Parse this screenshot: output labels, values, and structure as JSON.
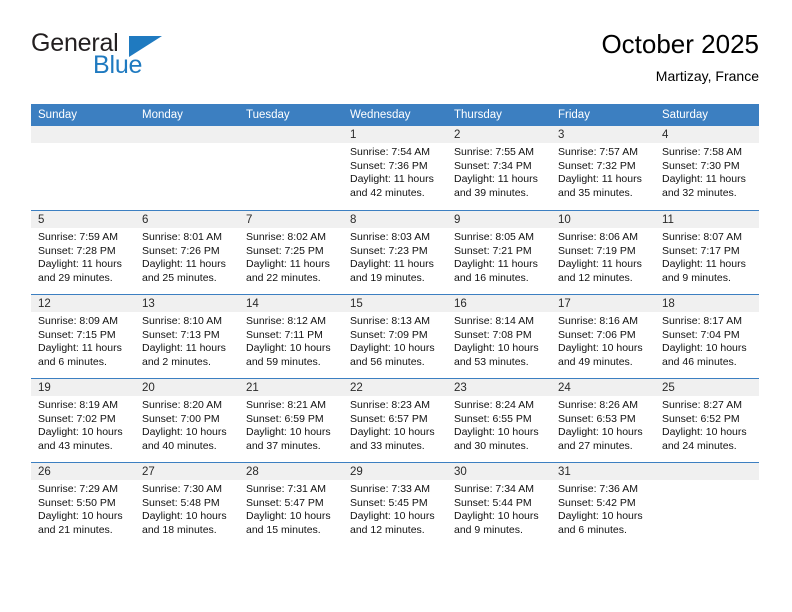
{
  "brand": {
    "name_top": "General",
    "name_bottom": "Blue",
    "triangle_color": "#1f7ac0",
    "text_color": "#231f20"
  },
  "header": {
    "title": "October 2025",
    "subtitle": "Martizay, France"
  },
  "theme": {
    "header_row_bg": "#3c7fc1",
    "header_row_text": "#ffffff",
    "daynum_band_bg": "#f0f0f0",
    "week_separator": "#3c7fc1"
  },
  "weekday_headers": [
    "Sunday",
    "Monday",
    "Tuesday",
    "Wednesday",
    "Thursday",
    "Friday",
    "Saturday"
  ],
  "weeks": [
    [
      {
        "day": "",
        "sunrise": "",
        "sunset": "",
        "daylight_line1": "",
        "daylight_line2": ""
      },
      {
        "day": "",
        "sunrise": "",
        "sunset": "",
        "daylight_line1": "",
        "daylight_line2": ""
      },
      {
        "day": "",
        "sunrise": "",
        "sunset": "",
        "daylight_line1": "",
        "daylight_line2": ""
      },
      {
        "day": "1",
        "sunrise": "Sunrise: 7:54 AM",
        "sunset": "Sunset: 7:36 PM",
        "daylight_line1": "Daylight: 11 hours",
        "daylight_line2": "and 42 minutes."
      },
      {
        "day": "2",
        "sunrise": "Sunrise: 7:55 AM",
        "sunset": "Sunset: 7:34 PM",
        "daylight_line1": "Daylight: 11 hours",
        "daylight_line2": "and 39 minutes."
      },
      {
        "day": "3",
        "sunrise": "Sunrise: 7:57 AM",
        "sunset": "Sunset: 7:32 PM",
        "daylight_line1": "Daylight: 11 hours",
        "daylight_line2": "and 35 minutes."
      },
      {
        "day": "4",
        "sunrise": "Sunrise: 7:58 AM",
        "sunset": "Sunset: 7:30 PM",
        "daylight_line1": "Daylight: 11 hours",
        "daylight_line2": "and 32 minutes."
      }
    ],
    [
      {
        "day": "5",
        "sunrise": "Sunrise: 7:59 AM",
        "sunset": "Sunset: 7:28 PM",
        "daylight_line1": "Daylight: 11 hours",
        "daylight_line2": "and 29 minutes."
      },
      {
        "day": "6",
        "sunrise": "Sunrise: 8:01 AM",
        "sunset": "Sunset: 7:26 PM",
        "daylight_line1": "Daylight: 11 hours",
        "daylight_line2": "and 25 minutes."
      },
      {
        "day": "7",
        "sunrise": "Sunrise: 8:02 AM",
        "sunset": "Sunset: 7:25 PM",
        "daylight_line1": "Daylight: 11 hours",
        "daylight_line2": "and 22 minutes."
      },
      {
        "day": "8",
        "sunrise": "Sunrise: 8:03 AM",
        "sunset": "Sunset: 7:23 PM",
        "daylight_line1": "Daylight: 11 hours",
        "daylight_line2": "and 19 minutes."
      },
      {
        "day": "9",
        "sunrise": "Sunrise: 8:05 AM",
        "sunset": "Sunset: 7:21 PM",
        "daylight_line1": "Daylight: 11 hours",
        "daylight_line2": "and 16 minutes."
      },
      {
        "day": "10",
        "sunrise": "Sunrise: 8:06 AM",
        "sunset": "Sunset: 7:19 PM",
        "daylight_line1": "Daylight: 11 hours",
        "daylight_line2": "and 12 minutes."
      },
      {
        "day": "11",
        "sunrise": "Sunrise: 8:07 AM",
        "sunset": "Sunset: 7:17 PM",
        "daylight_line1": "Daylight: 11 hours",
        "daylight_line2": "and 9 minutes."
      }
    ],
    [
      {
        "day": "12",
        "sunrise": "Sunrise: 8:09 AM",
        "sunset": "Sunset: 7:15 PM",
        "daylight_line1": "Daylight: 11 hours",
        "daylight_line2": "and 6 minutes."
      },
      {
        "day": "13",
        "sunrise": "Sunrise: 8:10 AM",
        "sunset": "Sunset: 7:13 PM",
        "daylight_line1": "Daylight: 11 hours",
        "daylight_line2": "and 2 minutes."
      },
      {
        "day": "14",
        "sunrise": "Sunrise: 8:12 AM",
        "sunset": "Sunset: 7:11 PM",
        "daylight_line1": "Daylight: 10 hours",
        "daylight_line2": "and 59 minutes."
      },
      {
        "day": "15",
        "sunrise": "Sunrise: 8:13 AM",
        "sunset": "Sunset: 7:09 PM",
        "daylight_line1": "Daylight: 10 hours",
        "daylight_line2": "and 56 minutes."
      },
      {
        "day": "16",
        "sunrise": "Sunrise: 8:14 AM",
        "sunset": "Sunset: 7:08 PM",
        "daylight_line1": "Daylight: 10 hours",
        "daylight_line2": "and 53 minutes."
      },
      {
        "day": "17",
        "sunrise": "Sunrise: 8:16 AM",
        "sunset": "Sunset: 7:06 PM",
        "daylight_line1": "Daylight: 10 hours",
        "daylight_line2": "and 49 minutes."
      },
      {
        "day": "18",
        "sunrise": "Sunrise: 8:17 AM",
        "sunset": "Sunset: 7:04 PM",
        "daylight_line1": "Daylight: 10 hours",
        "daylight_line2": "and 46 minutes."
      }
    ],
    [
      {
        "day": "19",
        "sunrise": "Sunrise: 8:19 AM",
        "sunset": "Sunset: 7:02 PM",
        "daylight_line1": "Daylight: 10 hours",
        "daylight_line2": "and 43 minutes."
      },
      {
        "day": "20",
        "sunrise": "Sunrise: 8:20 AM",
        "sunset": "Sunset: 7:00 PM",
        "daylight_line1": "Daylight: 10 hours",
        "daylight_line2": "and 40 minutes."
      },
      {
        "day": "21",
        "sunrise": "Sunrise: 8:21 AM",
        "sunset": "Sunset: 6:59 PM",
        "daylight_line1": "Daylight: 10 hours",
        "daylight_line2": "and 37 minutes."
      },
      {
        "day": "22",
        "sunrise": "Sunrise: 8:23 AM",
        "sunset": "Sunset: 6:57 PM",
        "daylight_line1": "Daylight: 10 hours",
        "daylight_line2": "and 33 minutes."
      },
      {
        "day": "23",
        "sunrise": "Sunrise: 8:24 AM",
        "sunset": "Sunset: 6:55 PM",
        "daylight_line1": "Daylight: 10 hours",
        "daylight_line2": "and 30 minutes."
      },
      {
        "day": "24",
        "sunrise": "Sunrise: 8:26 AM",
        "sunset": "Sunset: 6:53 PM",
        "daylight_line1": "Daylight: 10 hours",
        "daylight_line2": "and 27 minutes."
      },
      {
        "day": "25",
        "sunrise": "Sunrise: 8:27 AM",
        "sunset": "Sunset: 6:52 PM",
        "daylight_line1": "Daylight: 10 hours",
        "daylight_line2": "and 24 minutes."
      }
    ],
    [
      {
        "day": "26",
        "sunrise": "Sunrise: 7:29 AM",
        "sunset": "Sunset: 5:50 PM",
        "daylight_line1": "Daylight: 10 hours",
        "daylight_line2": "and 21 minutes."
      },
      {
        "day": "27",
        "sunrise": "Sunrise: 7:30 AM",
        "sunset": "Sunset: 5:48 PM",
        "daylight_line1": "Daylight: 10 hours",
        "daylight_line2": "and 18 minutes."
      },
      {
        "day": "28",
        "sunrise": "Sunrise: 7:31 AM",
        "sunset": "Sunset: 5:47 PM",
        "daylight_line1": "Daylight: 10 hours",
        "daylight_line2": "and 15 minutes."
      },
      {
        "day": "29",
        "sunrise": "Sunrise: 7:33 AM",
        "sunset": "Sunset: 5:45 PM",
        "daylight_line1": "Daylight: 10 hours",
        "daylight_line2": "and 12 minutes."
      },
      {
        "day": "30",
        "sunrise": "Sunrise: 7:34 AM",
        "sunset": "Sunset: 5:44 PM",
        "daylight_line1": "Daylight: 10 hours",
        "daylight_line2": "and 9 minutes."
      },
      {
        "day": "31",
        "sunrise": "Sunrise: 7:36 AM",
        "sunset": "Sunset: 5:42 PM",
        "daylight_line1": "Daylight: 10 hours",
        "daylight_line2": "and 6 minutes."
      },
      {
        "day": "",
        "sunrise": "",
        "sunset": "",
        "daylight_line1": "",
        "daylight_line2": ""
      }
    ]
  ]
}
